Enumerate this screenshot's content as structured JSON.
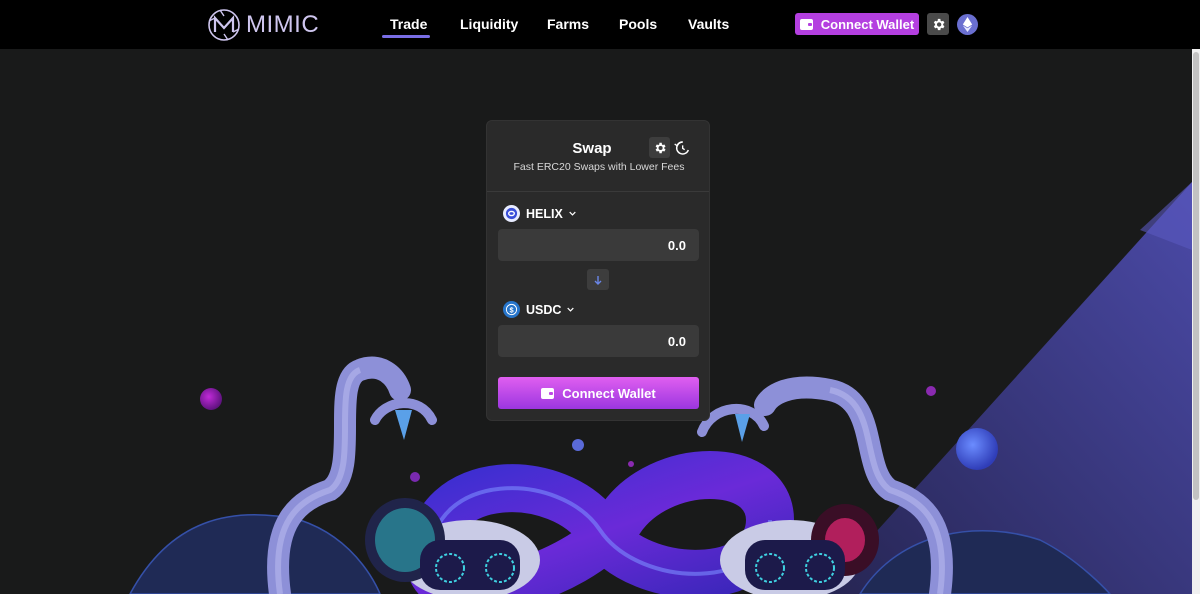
{
  "brand": {
    "name": "MIMIC"
  },
  "nav": {
    "links": [
      {
        "label": "Trade",
        "active": true
      },
      {
        "label": "Liquidity"
      },
      {
        "label": "Farms"
      },
      {
        "label": "Pools"
      },
      {
        "label": "Vaults"
      }
    ],
    "connect_wallet_label": "Connect Wallet",
    "network_icon": "ethereum-icon"
  },
  "swap": {
    "title": "Swap",
    "subtitle": "Fast ERC20 Swaps with Lower Fees",
    "from": {
      "token": "HELIX",
      "amount": "0.0"
    },
    "to": {
      "token": "USDC",
      "amount": "0.0"
    },
    "connect_wallet_label": "Connect Wallet"
  },
  "colors": {
    "accent": "#b43fe0",
    "nav_underline": "#7a6ee6",
    "card_bg": "#2a2a2a",
    "page_bg": "#191a1a"
  }
}
